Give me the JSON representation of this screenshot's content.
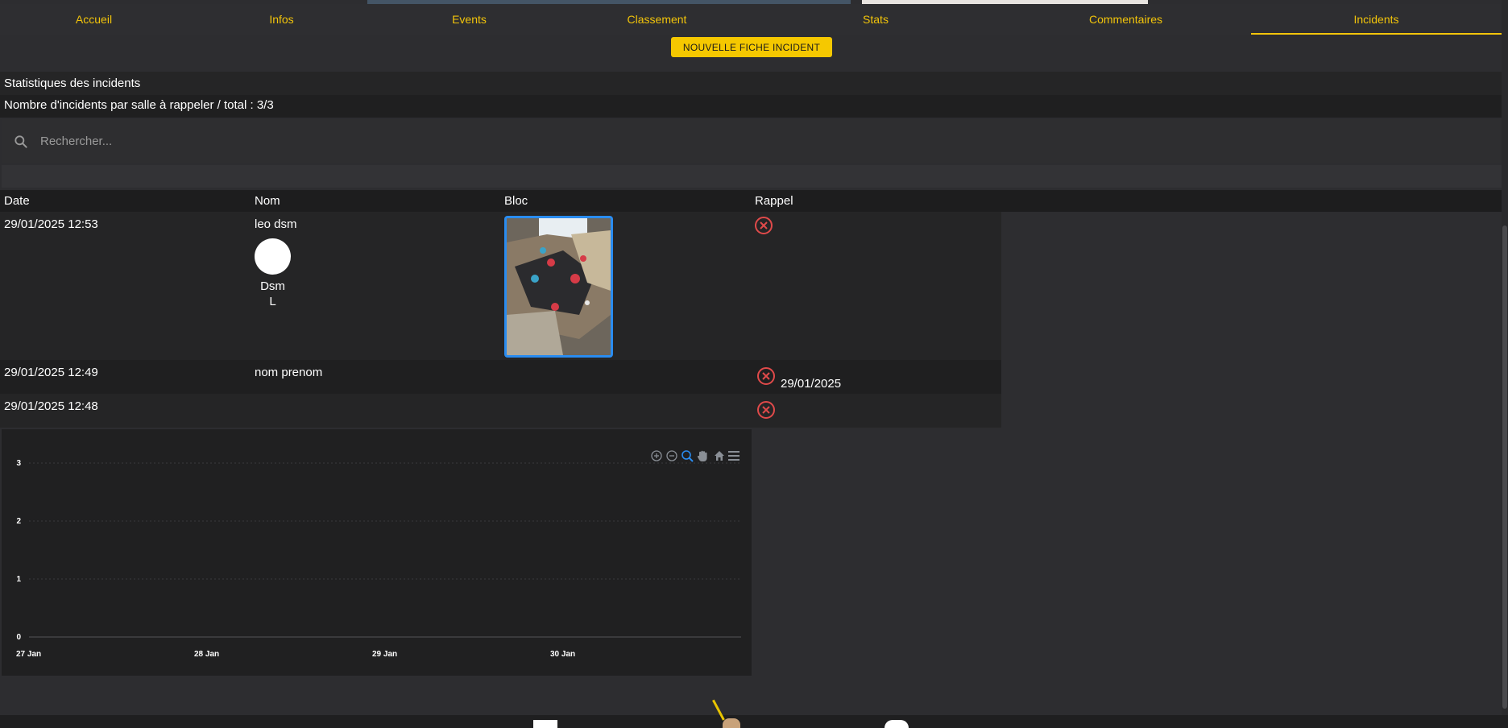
{
  "nav": {
    "tabs": [
      {
        "label": "Accueil"
      },
      {
        "label": "Infos"
      },
      {
        "label": "Events"
      },
      {
        "label": "Classement"
      },
      {
        "label": "Stats"
      },
      {
        "label": "Commentaires"
      },
      {
        "label": "Incidents",
        "active": true
      }
    ]
  },
  "actions": {
    "new_incident_label": "NOUVELLE FICHE INCIDENT"
  },
  "stats": {
    "title": "Statistiques des incidents",
    "count_line": "Nombre d'incidents par salle à rappeler / total : 3/3"
  },
  "search": {
    "placeholder": "Rechercher..."
  },
  "table": {
    "headers": {
      "date": "Date",
      "nom": "Nom",
      "bloc": "Bloc",
      "rappel": "Rappel"
    },
    "rows": [
      {
        "date": "29/01/2025 12:53",
        "nom": "leo dsm",
        "avatar_first": "Dsm",
        "avatar_last": "L",
        "has_photo": true,
        "rappel_date": ""
      },
      {
        "date": "29/01/2025 12:49",
        "nom": "nom prenom",
        "rappel_date": "29/01/2025"
      },
      {
        "date": "29/01/2025 12:48",
        "nom": "",
        "rappel_date": ""
      }
    ]
  },
  "colors": {
    "accent": "#f2c40a",
    "rappel_icon": "#e04a4a",
    "image_border": "#2a8cf0"
  },
  "chart_data": {
    "type": "bar",
    "x": [
      "27 Jan",
      "28 Jan",
      "29 Jan",
      "30 Jan"
    ],
    "y_ticks": [
      "0",
      "1",
      "2",
      "3"
    ],
    "ylim": [
      0,
      3
    ],
    "grid": true,
    "toolbar_icons": [
      "zoom-in-icon",
      "zoom-out-icon",
      "selection-zoom-icon",
      "pan-icon",
      "reset-home-icon",
      "menu-icon"
    ]
  }
}
